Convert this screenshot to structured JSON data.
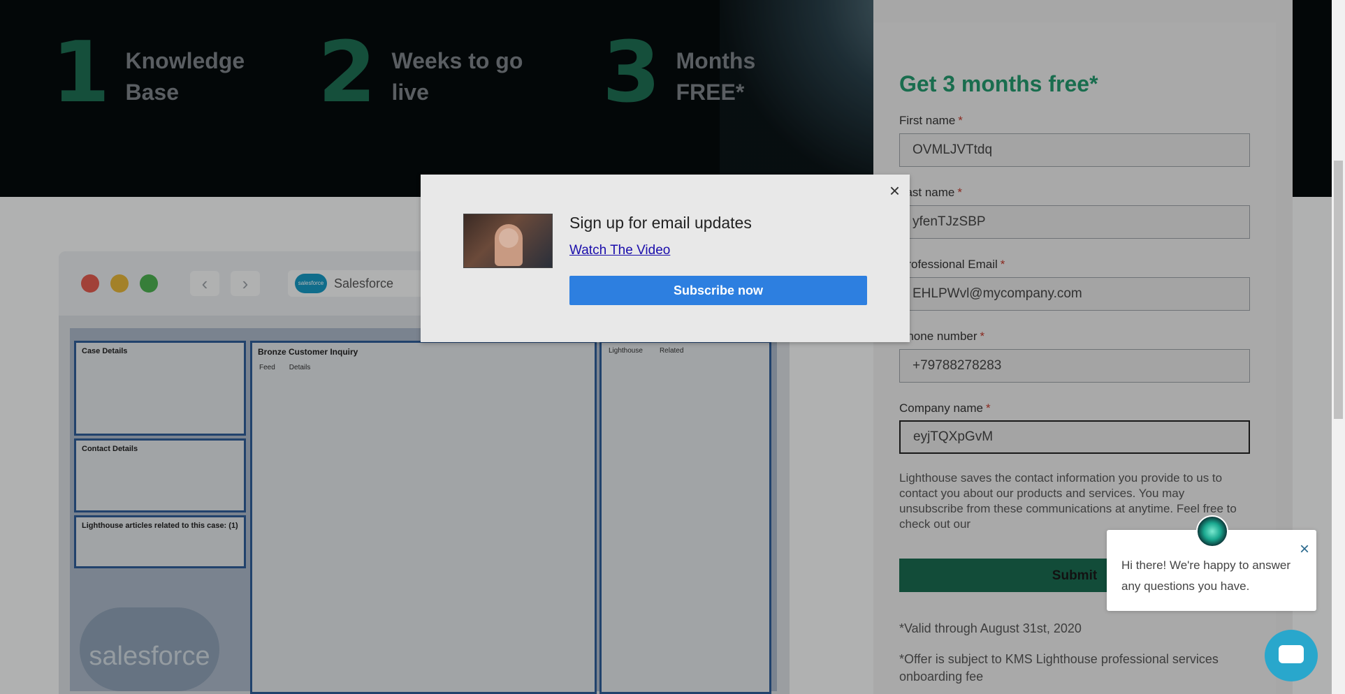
{
  "hero": {
    "stats": [
      {
        "number": "1",
        "text": "Knowledge Base"
      },
      {
        "number": "2",
        "text": "Weeks to go live"
      },
      {
        "number": "3",
        "text": "Months FREE*"
      }
    ]
  },
  "mockup": {
    "app_label": "Salesforce",
    "big_logo": "salesforce",
    "case_details_title": "Case Details",
    "contact_details_title": "Contact Details",
    "articles_title": "Lighthouse articles related to this case: (1)",
    "case_title": "Bronze Customer Inquiry",
    "tab_feed": "Feed",
    "tab_details": "Details",
    "lighthouse_tab": "Lighthouse",
    "related_tab": "Related"
  },
  "form": {
    "heading": "Get 3 months free*",
    "first_name_label": "First name",
    "first_name_value": "OVMLJVTtdq",
    "last_name_label": "Last name",
    "last_name_value": "yfenTJzSBP",
    "email_label": "Professional Email",
    "email_value": "EHLPWvl@mycompany.com",
    "phone_label": "Phone number",
    "phone_value": "+79788278283",
    "company_label": "Company name",
    "company_value": "eyjTQXpGvM",
    "required_mark": "*",
    "consent_text": "Lighthouse saves the contact information you provide to us to contact you about our products and services. You may unsubscribe from these communications at anytime. Feel free to check out our",
    "submit_label": "Submit",
    "valid_note": "*Valid through August 31st, 2020",
    "offer_note": "*Offer is subject to KMS Lighthouse professional services onboarding fee"
  },
  "modal": {
    "title": "Sign up for email updates",
    "link": "Watch The Video",
    "button": "Subscribe now",
    "close": "×"
  },
  "chat": {
    "message": "Hi there! We're happy to answer any questions you have.",
    "close": "×"
  },
  "colors": {
    "accent_green": "#23976c",
    "subscribe_blue": "#2d7fe0",
    "chat_blue": "#29a7cc"
  }
}
